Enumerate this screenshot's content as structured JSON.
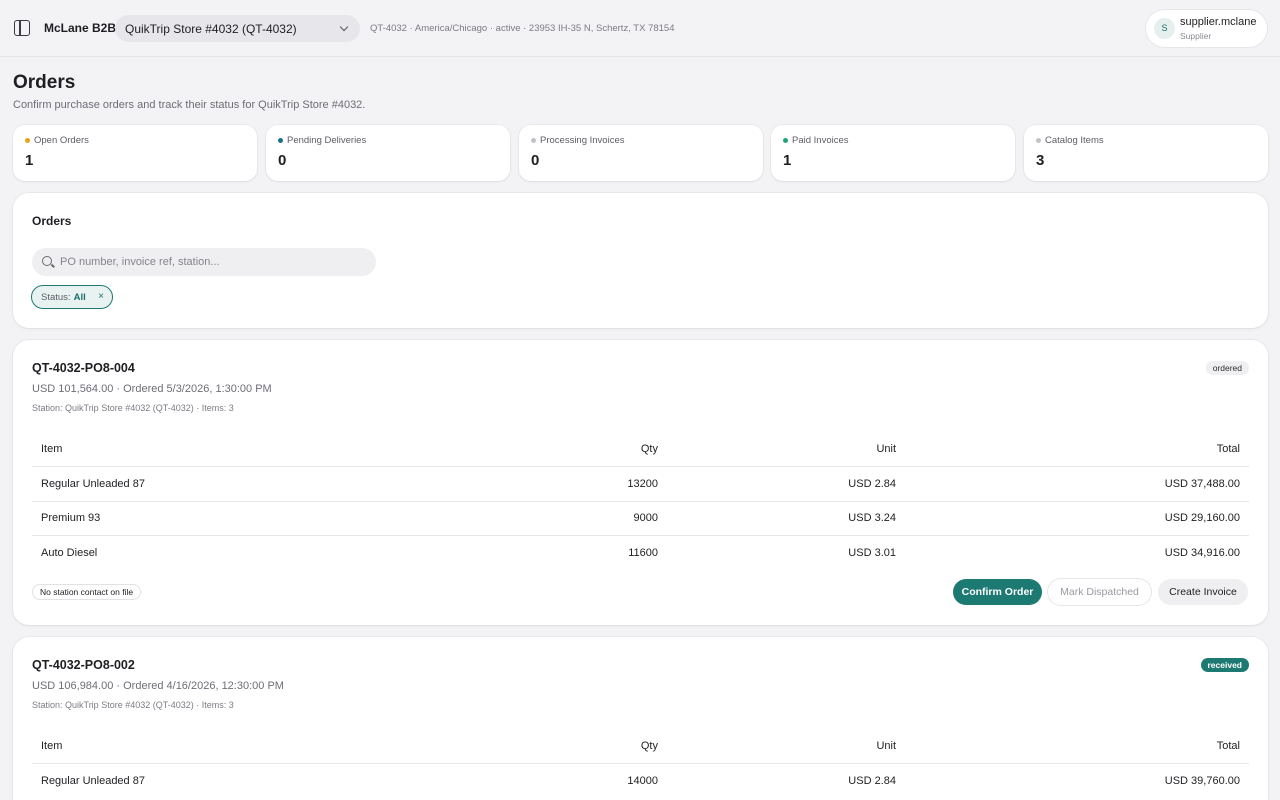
{
  "topbar": {
    "brand": "McLane B2B",
    "store_select": "QuikTrip Store #4032 (QT-4032)",
    "store_meta": "QT-4032 · America/Chicago · active · 23953 IH-35 N, Schertz, TX 78154",
    "user": {
      "initial": "S",
      "name": "supplier.mclane",
      "role": "Supplier"
    }
  },
  "page": {
    "title": "Orders",
    "subtitle": "Confirm purchase orders and track their status for QuikTrip Store #4032."
  },
  "stats": [
    {
      "label": "Open Orders",
      "value": "1",
      "color": "#e8a317"
    },
    {
      "label": "Pending Deliveries",
      "value": "0",
      "color": "#1d6f8a"
    },
    {
      "label": "Processing Invoices",
      "value": "0",
      "color": "#c3c2c8"
    },
    {
      "label": "Paid Invoices",
      "value": "1",
      "color": "#1fa37a"
    },
    {
      "label": "Catalog Items",
      "value": "3",
      "color": "#c3c2c8"
    }
  ],
  "filters": {
    "title": "Orders",
    "search_placeholder": "PO number, invoice ref, station...",
    "status_key": "Status:",
    "status_value": "All",
    "status_clear": "×"
  },
  "table_headers": {
    "item": "Item",
    "qty": "Qty",
    "unit": "Unit",
    "total": "Total"
  },
  "orders": [
    {
      "po": "QT-4032-PO8-004",
      "meta": "USD 101,564.00 · Ordered 5/3/2026, 1:30:00 PM",
      "station": "Station: QuikTrip Store #4032 (QT-4032) · Items: 3",
      "status": "ordered",
      "items": [
        {
          "item": "Regular Unleaded 87",
          "qty": "13200",
          "unit": "USD 2.84",
          "total": "USD 37,488.00"
        },
        {
          "item": "Premium 93",
          "qty": "9000",
          "unit": "USD 3.24",
          "total": "USD 29,160.00"
        },
        {
          "item": "Auto Diesel",
          "qty": "11600",
          "unit": "USD 3.01",
          "total": "USD 34,916.00"
        }
      ],
      "contact": "No station contact on file",
      "actions": {
        "confirm": "Confirm Order",
        "dispatch": "Mark Dispatched",
        "invoice": "Create Invoice"
      }
    },
    {
      "po": "QT-4032-PO8-002",
      "meta": "USD 106,984.00 · Ordered 4/16/2026, 12:30:00 PM",
      "station": "Station: QuikTrip Store #4032 (QT-4032) · Items: 3",
      "status": "received",
      "items": [
        {
          "item": "Regular Unleaded 87",
          "qty": "14000",
          "unit": "USD 2.84",
          "total": "USD 39,760.00"
        }
      ]
    }
  ]
}
